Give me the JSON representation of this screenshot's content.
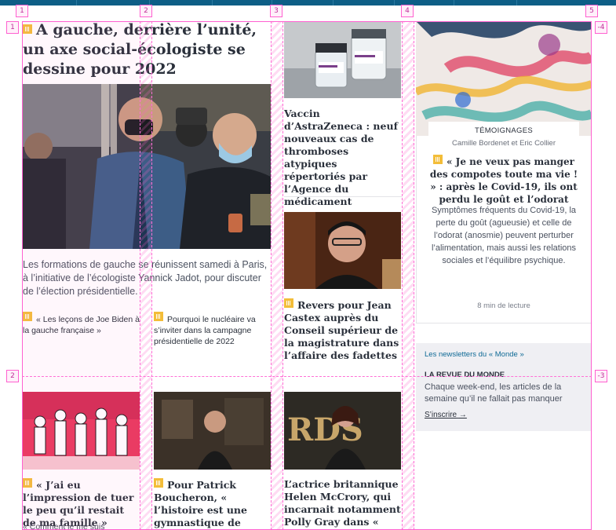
{
  "grid": {
    "columns": [
      "1",
      "2",
      "3",
      "4",
      "5"
    ],
    "row_markers_left": [
      "1",
      "2"
    ],
    "row_markers_right": [
      "-4",
      "-3"
    ]
  },
  "main": {
    "headline": "A gauche, derrière l’unité, un axe social-écologiste se dessine pour 2022",
    "lede": "Les formations de gauche se réunissent samedi à Paris, à l’initiative de l’écologiste Yannick Jadot, pour discuter de l’élection présidentielle.",
    "related": [
      "« Les leçons de Joe Biden à la gauche française »",
      "Pourquoi le nucléaire va s’inviter dans la campagne présidentielle de 2022"
    ]
  },
  "cards": {
    "vaccine": "Vaccin d’AstraZeneca : neuf nouveaux cas de thromboses atypiques répertoriés par l’Agence du médicament",
    "castex": "Revers pour Jean Castex auprès du Conseil supérieur de la magistrature dans l’affaire des fadettes",
    "impression": "« J’ai eu l’impression de tuer le peu qu’il restait de ma famille »",
    "impression_sub": "« Comment je me suis",
    "boucheron": "Pour Patrick Boucheron, « l’histoire est une gymnastique de l’inquiétude, elle",
    "mccrory": "L’actrice britannique Helen McCrory, qui incarnait notamment Polly Gray dans « Peaky Blinders »"
  },
  "testimony": {
    "label": "TÉMOIGNAGES",
    "authors": "Camille Bordenet et Eric Collier",
    "title": "« Je ne veux pas manger des compotes toute ma vie ! » : après le Covid-19, ils ont perdu le goût et l’odorat",
    "description": "Symptômes fréquents du Covid-19, la perte du goût (agueusie) et celle de l’odorat (anosmie) peuvent perturber l’alimentation, mais aussi les relations sociales et l’équilibre psychique.",
    "reading_time": "8 min de lecture"
  },
  "newsletter": {
    "heading": "Les newsletters du « Monde »",
    "title": "LA REVUE DU MONDE",
    "description": "Chaque week-end, les articles de la semaine qu’il ne fallait pas manquer",
    "cta": "S’inscrire",
    "cta_icon": "arrow-right-icon"
  },
  "colors": {
    "live_badge": "#f3bd39",
    "topbar": "#0d5e86",
    "grid_overlay": "#ff60d0",
    "link_blue": "#0f6a96"
  }
}
